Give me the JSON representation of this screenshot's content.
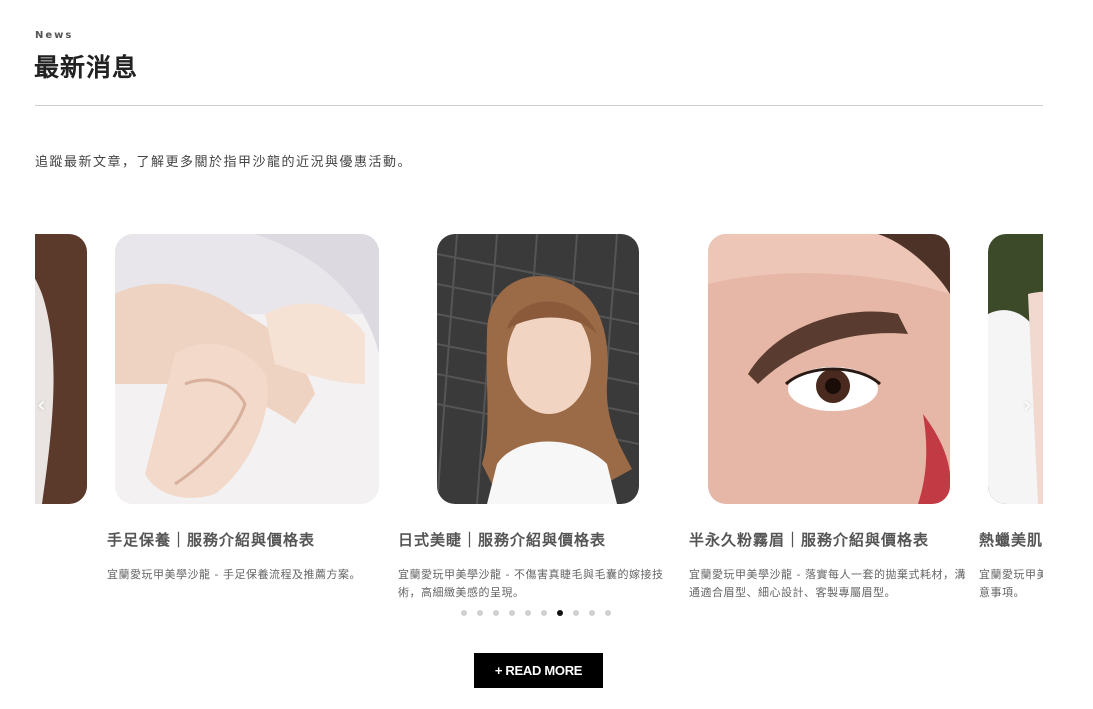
{
  "section": {
    "eyebrow": "News",
    "title": "最新消息",
    "intro": "追蹤最新文章，了解更多關於指甲沙龍的近況與優惠活動。"
  },
  "carousel": {
    "prev_icon": "chevron-left-icon",
    "next_icon": "chevron-right-icon",
    "cards": [
      {
        "title": "",
        "desc": "",
        "image": "photo-woman-hair-partial"
      },
      {
        "title": "手足保養｜服務介紹與價格表",
        "desc": "宜蘭愛玩甲美學沙龍 - 手足保養流程及推薦方案。",
        "image": "photo-hands-care"
      },
      {
        "title": "日式美睫｜服務介紹與價格表",
        "desc": "宜蘭愛玩甲美學沙龍 - 不傷害真睫毛與毛囊的嫁接技術，高細緻美感的呈現。",
        "image": "photo-woman-eyelash"
      },
      {
        "title": "半永久粉霧眉｜服務介紹與價格表",
        "desc": "宜蘭愛玩甲美學沙龍 - 落實每人一套的拋棄式耗材，溝通適合眉型、細心設計、客製專屬眉型。",
        "image": "photo-eyebrow-closeup"
      },
      {
        "title": "熱蠟美肌｜服務介紹與價格表",
        "desc": "宜蘭愛玩甲美學沙龍 - 熱蠟除毛流程、術後保養以及注意事項。",
        "image": "photo-skin-partial"
      }
    ],
    "dots_total": 10,
    "dots_active_index": 6
  },
  "cta": {
    "label": "+ READ MORE"
  }
}
